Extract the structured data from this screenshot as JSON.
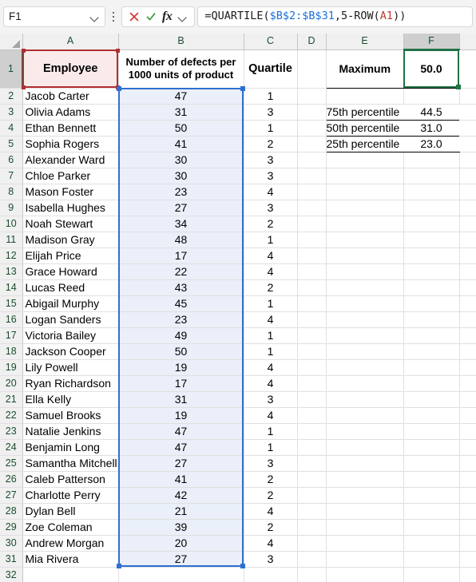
{
  "app": "spreadsheet",
  "formula_bar": {
    "name_box_value": "F1",
    "name_box_placeholder": "Name Box",
    "cancel_icon": "cancel-x-icon",
    "confirm_icon": "confirm-check-icon",
    "function_label": "fx",
    "formula_text": "=QUARTILE($B$2:$B$31,5-ROW(A1))",
    "formula_parts": {
      "p1": "=QUARTILE(",
      "ref1": "$B$2:$B$31",
      "p2": ",5-ROW(",
      "ref2": "A1",
      "p3": "))"
    }
  },
  "grid": {
    "column_headers": [
      "A",
      "B",
      "C",
      "D",
      "E",
      "F"
    ],
    "active_column": "F",
    "active_row": "1",
    "active_cell": "F1",
    "row_numbers": [
      "1",
      "2",
      "3",
      "4",
      "5",
      "6",
      "7",
      "8",
      "9",
      "10",
      "11",
      "12",
      "13",
      "14",
      "15",
      "16",
      "17",
      "18",
      "19",
      "20",
      "21",
      "22",
      "23",
      "24",
      "25",
      "26",
      "27",
      "28",
      "29",
      "30",
      "31",
      "32"
    ]
  },
  "headers": {
    "employee": "Employee",
    "defects_line1": "Number of defects per",
    "defects_line2": "1000 units of product",
    "quartile": "Quartile"
  },
  "stats": {
    "rows": [
      {
        "label": "Maximum",
        "value": "50.0"
      },
      {
        "label": "75th percentile",
        "value": "44.5"
      },
      {
        "label": "50th percentile",
        "value": "31.0"
      },
      {
        "label": "25th percentile",
        "value": "23.0"
      }
    ]
  },
  "table": {
    "columns": [
      "Employee",
      "Number of defects per 1000 units of product",
      "Quartile"
    ],
    "rows": [
      {
        "row": "2",
        "employee": "Jacob Carter",
        "defects": "47",
        "quartile": "1"
      },
      {
        "row": "3",
        "employee": "Olivia Adams",
        "defects": "31",
        "quartile": "3"
      },
      {
        "row": "4",
        "employee": "Ethan Bennett",
        "defects": "50",
        "quartile": "1"
      },
      {
        "row": "5",
        "employee": "Sophia Rogers",
        "defects": "41",
        "quartile": "2"
      },
      {
        "row": "6",
        "employee": "Alexander Ward",
        "defects": "30",
        "quartile": "3"
      },
      {
        "row": "7",
        "employee": "Chloe Parker",
        "defects": "30",
        "quartile": "3"
      },
      {
        "row": "8",
        "employee": "Mason Foster",
        "defects": "23",
        "quartile": "4"
      },
      {
        "row": "9",
        "employee": "Isabella Hughes",
        "defects": "27",
        "quartile": "3"
      },
      {
        "row": "10",
        "employee": "Noah Stewart",
        "defects": "34",
        "quartile": "2"
      },
      {
        "row": "11",
        "employee": "Madison Gray",
        "defects": "48",
        "quartile": "1"
      },
      {
        "row": "12",
        "employee": "Elijah Price",
        "defects": "17",
        "quartile": "4"
      },
      {
        "row": "13",
        "employee": "Grace Howard",
        "defects": "22",
        "quartile": "4"
      },
      {
        "row": "14",
        "employee": "Lucas Reed",
        "defects": "43",
        "quartile": "2"
      },
      {
        "row": "15",
        "employee": "Abigail Murphy",
        "defects": "45",
        "quartile": "1"
      },
      {
        "row": "16",
        "employee": "Logan Sanders",
        "defects": "23",
        "quartile": "4"
      },
      {
        "row": "17",
        "employee": "Victoria Bailey",
        "defects": "49",
        "quartile": "1"
      },
      {
        "row": "18",
        "employee": "Jackson Cooper",
        "defects": "50",
        "quartile": "1"
      },
      {
        "row": "19",
        "employee": "Lily Powell",
        "defects": "19",
        "quartile": "4"
      },
      {
        "row": "20",
        "employee": "Ryan Richardson",
        "defects": "17",
        "quartile": "4"
      },
      {
        "row": "21",
        "employee": "Ella Kelly",
        "defects": "31",
        "quartile": "3"
      },
      {
        "row": "22",
        "employee": "Samuel Brooks",
        "defects": "19",
        "quartile": "4"
      },
      {
        "row": "23",
        "employee": "Natalie Jenkins",
        "defects": "47",
        "quartile": "1"
      },
      {
        "row": "24",
        "employee": "Benjamin Long",
        "defects": "47",
        "quartile": "1"
      },
      {
        "row": "25",
        "employee": "Samantha Mitchell",
        "defects": "27",
        "quartile": "3"
      },
      {
        "row": "26",
        "employee": "Caleb Patterson",
        "defects": "41",
        "quartile": "2"
      },
      {
        "row": "27",
        "employee": "Charlotte Perry",
        "defects": "42",
        "quartile": "2"
      },
      {
        "row": "28",
        "employee": "Dylan Bell",
        "defects": "21",
        "quartile": "4"
      },
      {
        "row": "29",
        "employee": "Zoe Coleman",
        "defects": "39",
        "quartile": "2"
      },
      {
        "row": "30",
        "employee": "Andrew Morgan",
        "defects": "20",
        "quartile": "4"
      },
      {
        "row": "31",
        "employee": "Mia Rivera",
        "defects": "27",
        "quartile": "3"
      }
    ]
  },
  "colors": {
    "accent_green": "#217346",
    "ref_blue": "#2f6fd0",
    "ref_red": "#b03030",
    "header_fill_pink": "#fbeaea",
    "range_fill_blue": "#eaeff9"
  }
}
